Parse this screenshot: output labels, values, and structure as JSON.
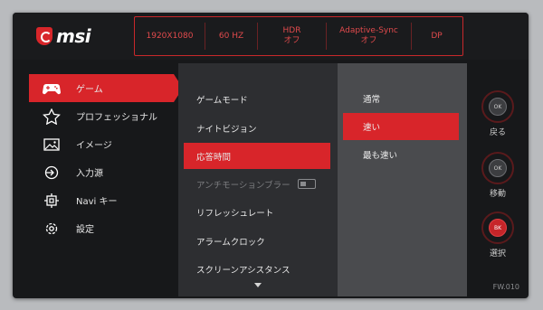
{
  "logo": {
    "text": "msi",
    "icon": "msi-dragon-shield-icon"
  },
  "info_bar": [
    {
      "line1": "1920X1080",
      "line2": ""
    },
    {
      "line1": "60 HZ",
      "line2": ""
    },
    {
      "line1": "HDR",
      "line2": "オフ"
    },
    {
      "line1": "Adaptive-Sync",
      "line2": "オフ"
    },
    {
      "line1": "DP",
      "line2": ""
    }
  ],
  "left_menu": [
    {
      "label": "ゲーム",
      "icon": "gamepad-icon",
      "active": true
    },
    {
      "label": "プロフェッショナル",
      "icon": "star-icon",
      "active": false
    },
    {
      "label": "イメージ",
      "icon": "image-icon",
      "active": false
    },
    {
      "label": "入力源",
      "icon": "input-source-icon",
      "active": false
    },
    {
      "label": "Navi キー",
      "icon": "navi-key-icon",
      "active": false
    },
    {
      "label": "設定",
      "icon": "gear-icon",
      "active": false
    }
  ],
  "mid_menu": [
    {
      "label": "ゲームモード",
      "state": "normal"
    },
    {
      "label": "ナイトビジョン",
      "state": "normal"
    },
    {
      "label": "応答時間",
      "state": "active"
    },
    {
      "label": "アンチモーションブラー",
      "state": "disabled",
      "toggle": "off"
    },
    {
      "label": "リフレッシュレート",
      "state": "normal"
    },
    {
      "label": "アラームクロック",
      "state": "normal"
    },
    {
      "label": "スクリーンアシスタンス",
      "state": "normal"
    }
  ],
  "options": [
    {
      "label": "通常",
      "active": false
    },
    {
      "label": "速い",
      "active": true
    },
    {
      "label": "最も速い",
      "active": false
    }
  ],
  "controls": [
    {
      "knob": "OK",
      "label": "戻る"
    },
    {
      "knob": "OK",
      "label": "移動"
    },
    {
      "knob": "BK",
      "label": "選択"
    }
  ],
  "firmware": "FW.010",
  "colors": {
    "accent": "#d8252a",
    "panel": "#17181a",
    "mid_panel": "#2d2e31",
    "option_panel": "#4a4b4e"
  }
}
